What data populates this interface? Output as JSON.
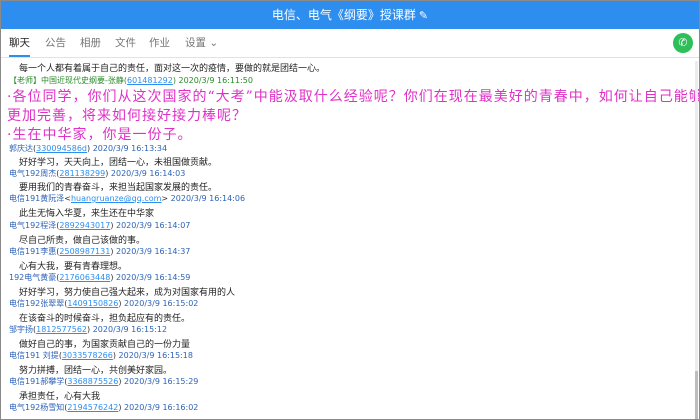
{
  "window": {
    "title": "电信、电气《纲要》授课群",
    "edit_icon": "pencil-icon"
  },
  "tabs": [
    {
      "label": "聊天",
      "active": true
    },
    {
      "label": "公告"
    },
    {
      "label": "相册"
    },
    {
      "label": "文件"
    },
    {
      "label": "作业"
    },
    {
      "label": "设置",
      "dropdown": true
    }
  ],
  "call_icon": "phone-icon",
  "messages": [
    {
      "text": "每一个人都有着属于自己的责任，面对这一次的疫情，要做的就是团结一心。"
    },
    {
      "sender": "【老师】中国近现代史纲要-张静",
      "qq": "601481292",
      "time": "2020/3/9 16:11:50",
      "teacher": true,
      "annot": [
        "·各位同学，你们从这次国家的“大考”中能汲取什么经验呢？你们在现在最美好的青春中，如何让自己能够",
        "更加完善，将来如何接好接力棒呢？",
        "·生在中华家，你是一份子。"
      ]
    },
    {
      "sender": "郭庆达",
      "qq": "330094586d",
      "time": "2020/3/9 16:13:34",
      "text": "好好学习，天天向上，团结一心，未祖国做贡献。"
    },
    {
      "sender": "电气192周杰",
      "qq": "281138299",
      "time": "2020/3/9 16:14:03",
      "text": "要用我们的青春奋斗，来担当起国家发展的责任。"
    },
    {
      "sender": "电信191黄阮泽",
      "qq": "huangruanze@qq.com",
      "time": "2020/3/9 16:14:06",
      "text": "此生无悔入华夏，来生还在中华家"
    },
    {
      "sender": "电气192程泽",
      "qq": "2892943017",
      "time": "2020/3/9 16:14:07",
      "text": "尽自己所责，做自己该做的事。"
    },
    {
      "sender": "电信191李惠",
      "qq": "2508987131",
      "time": "2020/3/9 16:14:37",
      "text": "心有大我，要有青春理想。"
    },
    {
      "sender": "192电气黄豪",
      "qq": "2176063448",
      "time": "2020/3/9 16:14:59",
      "text": "好好学习，努力使自己强大起来，成为对国家有用的人"
    },
    {
      "sender": "电信192张翠翠",
      "qq": "1409150826",
      "time": "2020/3/9 16:15:02",
      "text": "在该奋斗的时候奋斗，担负起应有的责任。"
    },
    {
      "sender": "邹宇扬",
      "qq": "1812577562",
      "time": "2020/3/9 16:15:12",
      "text": "做好自己的事，为国家贡献自己的一份力量"
    },
    {
      "sender": "电信191  刘提",
      "qq": "3033578266",
      "time": "2020/3/9 16:15:18",
      "text": "努力拼搏，团结一心，共创美好家园。"
    },
    {
      "sender": "电信191郝攀学",
      "qq": "3368875526",
      "time": "2020/3/9 16:15:29",
      "text": "承担责任，心有大我"
    },
    {
      "sender": "电气192杨雪知",
      "qq": "2194576242",
      "time": "2020/3/9 16:16:02"
    }
  ]
}
